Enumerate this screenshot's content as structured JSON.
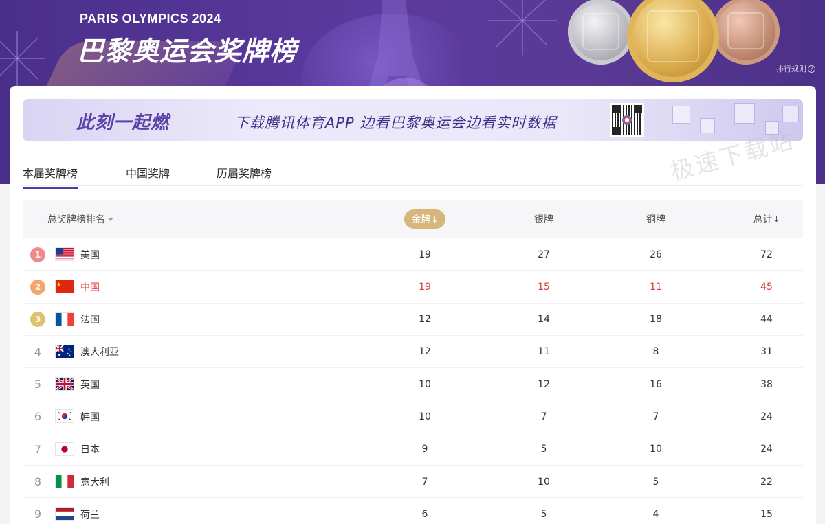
{
  "header": {
    "subtitle": "PARIS OLYMPICS 2024",
    "title": "巴黎奥运会奖牌榜",
    "rules_link": "排行规则"
  },
  "banner": {
    "slogan": "此刻一起燃",
    "promo": "下载腾讯体育APP  边看巴黎奥运会边看实时数据"
  },
  "watermark": "极速下载站",
  "tabs": [
    {
      "label": "本届奖牌榜",
      "active": true
    },
    {
      "label": "中国奖牌",
      "active": false
    },
    {
      "label": "历届奖牌榜",
      "active": false
    }
  ],
  "table": {
    "headers": {
      "rank": "总奖牌榜排名",
      "gold": "金牌",
      "silver": "银牌",
      "bronze": "铜牌",
      "total": "总计"
    },
    "rows": [
      {
        "rank": "1",
        "country": "美国",
        "flag": "us",
        "gold": "19",
        "silver": "27",
        "bronze": "26",
        "total": "72"
      },
      {
        "rank": "2",
        "country": "中国",
        "flag": "cn",
        "gold": "19",
        "silver": "15",
        "bronze": "11",
        "total": "45",
        "highlight": true
      },
      {
        "rank": "3",
        "country": "法国",
        "flag": "fr",
        "gold": "12",
        "silver": "14",
        "bronze": "18",
        "total": "44"
      },
      {
        "rank": "4",
        "country": "澳大利亚",
        "flag": "au",
        "gold": "12",
        "silver": "11",
        "bronze": "8",
        "total": "31"
      },
      {
        "rank": "5",
        "country": "英国",
        "flag": "gb",
        "gold": "10",
        "silver": "12",
        "bronze": "16",
        "total": "38"
      },
      {
        "rank": "6",
        "country": "韩国",
        "flag": "kr",
        "gold": "10",
        "silver": "7",
        "bronze": "7",
        "total": "24"
      },
      {
        "rank": "7",
        "country": "日本",
        "flag": "jp",
        "gold": "9",
        "silver": "5",
        "bronze": "10",
        "total": "24"
      },
      {
        "rank": "8",
        "country": "意大利",
        "flag": "it",
        "gold": "7",
        "silver": "10",
        "bronze": "5",
        "total": "22"
      },
      {
        "rank": "9",
        "country": "荷兰",
        "flag": "nl",
        "gold": "6",
        "silver": "5",
        "bronze": "4",
        "total": "15"
      }
    ]
  },
  "colors": {
    "hero_purple": "#5b3a9e",
    "highlight_red": "#e03b3b",
    "rank1": "#f08a8a",
    "rank2": "#f3a56b",
    "rank3": "#e1c26c",
    "gold_pill": "#d6b67a"
  }
}
